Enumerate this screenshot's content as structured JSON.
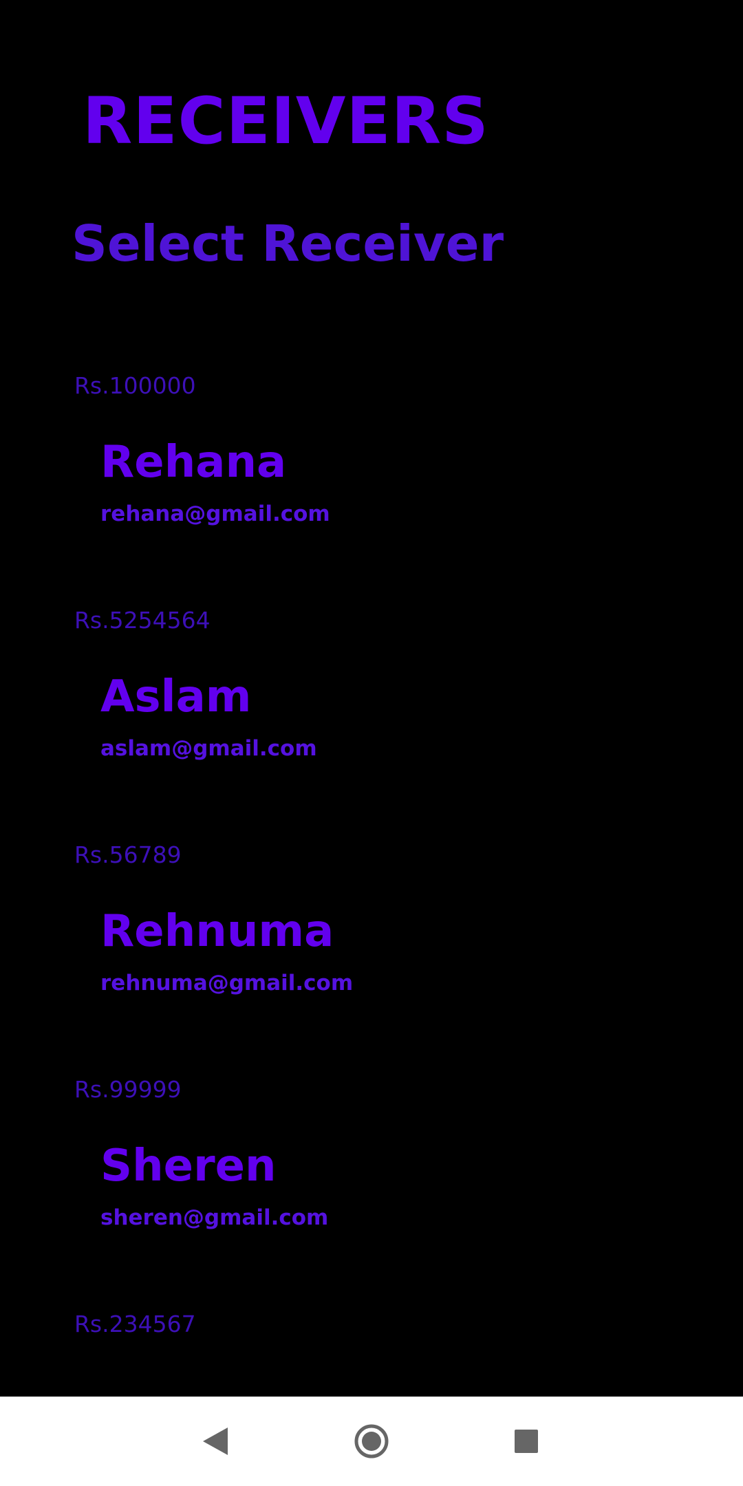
{
  "header": {
    "title": "RECEIVERS",
    "subtitle": "Select Receiver"
  },
  "receivers": [
    {
      "balance": "Rs.100000",
      "name": "Rehana",
      "email": "rehana@gmail.com"
    },
    {
      "balance": "Rs.5254564",
      "name": "Aslam",
      "email": "aslam@gmail.com"
    },
    {
      "balance": "Rs.56789",
      "name": "Rehnuma",
      "email": "rehnuma@gmail.com"
    },
    {
      "balance": "Rs.99999",
      "name": "Sheren",
      "email": "sheren@gmail.com"
    },
    {
      "balance": "Rs.234567",
      "name": "",
      "email": ""
    }
  ],
  "navbar": {
    "icons": [
      "back-triangle-icon",
      "home-circle-icon",
      "recents-square-icon"
    ]
  },
  "colors": {
    "background": "#000000",
    "accent": "#6200EE",
    "subtitle": "#4F14D6",
    "balance": "#3D10B8",
    "navbar": "#FFFFFF",
    "nav_icon": "#666666"
  }
}
